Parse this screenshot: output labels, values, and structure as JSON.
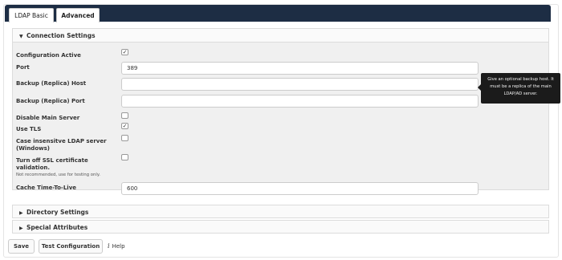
{
  "tabs": [
    {
      "label": "LDAP Basic"
    },
    {
      "label": "Advanced"
    }
  ],
  "sections": {
    "connection": {
      "title": "Connection Settings"
    },
    "directory": {
      "title": "Directory Settings"
    },
    "special": {
      "title": "Special Attributes"
    }
  },
  "fields": {
    "configuration_active": {
      "label": "Configuration Active",
      "checked": true
    },
    "port": {
      "label": "Port",
      "value": "389"
    },
    "backup_host": {
      "label": "Backup (Replica) Host",
      "value": ""
    },
    "backup_port": {
      "label": "Backup (Replica) Port",
      "value": ""
    },
    "disable_main_server": {
      "label": "Disable Main Server",
      "checked": false
    },
    "use_tls": {
      "label": "Use TLS",
      "checked": true
    },
    "case_insensitive_line1": "Case insensitve LDAP server",
    "case_insensitive_line2": "(Windows)",
    "turn_off_ssl_line1": "Turn off SSL certificate",
    "turn_off_ssl_line2": "validation.",
    "turn_off_ssl_hint": "Not recommended, use for testing only.",
    "cache_ttl": {
      "label": "Cache Time-To-Live",
      "value": "600"
    }
  },
  "tooltip": {
    "line1": "Give an optional backup host. It",
    "line2": "must be a replica of the main",
    "line3": "LDAP/AD server."
  },
  "actions": {
    "save": "Save",
    "test": "Test Configuration",
    "help": "Help"
  },
  "icons": {
    "section_open": "triangle-down-icon",
    "section_closed": "triangle-right-icon",
    "help": "info-icon",
    "check": "checkmark-icon"
  },
  "colors": {
    "tabbar": "#1d2d44",
    "section_body": "#f0f0f0",
    "tooltip": "#1b1b1b"
  }
}
